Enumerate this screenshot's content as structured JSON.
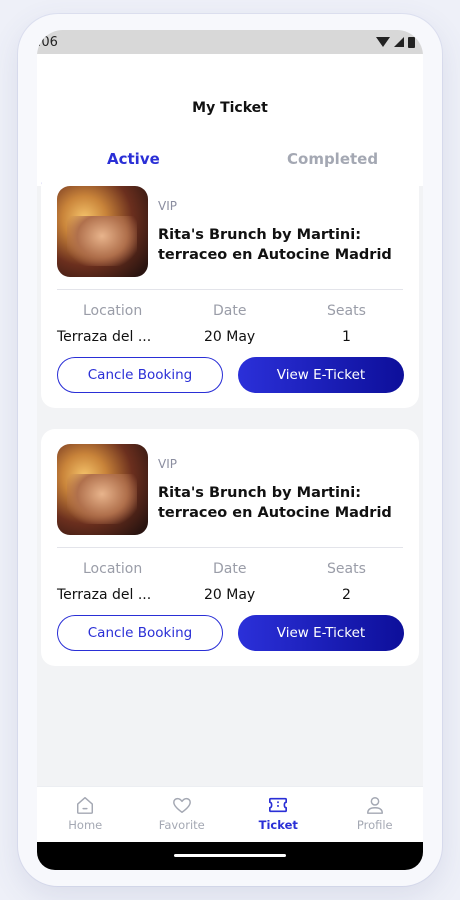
{
  "status": {
    "time": ":06"
  },
  "header": {
    "title": "My Ticket"
  },
  "tabs": [
    {
      "label": "Active",
      "active": true
    },
    {
      "label": "Completed",
      "active": false
    }
  ],
  "columns": {
    "location": "Location",
    "date": "Date",
    "seats": "Seats"
  },
  "tickets": [
    {
      "tier": "VIP",
      "title": "Rita's Brunch by Martini: terraceo en Autocine Madrid",
      "location": "Terraza del ...",
      "date": "20 May",
      "seats": "1",
      "cancel_label": "Cancle Booking",
      "view_label": "View E-Ticket"
    },
    {
      "tier": "VIP",
      "title": "Rita's Brunch by Martini: terraceo en Autocine Madrid",
      "location": "Terraza del ...",
      "date": "20 May",
      "seats": "2",
      "cancel_label": "Cancle Booking",
      "view_label": "View E-Ticket"
    }
  ],
  "nav": [
    {
      "label": "Home",
      "icon": "home-icon",
      "active": false
    },
    {
      "label": "Favorite",
      "icon": "heart-icon",
      "active": false
    },
    {
      "label": "Ticket",
      "icon": "ticket-icon",
      "active": true
    },
    {
      "label": "Profile",
      "icon": "user-icon",
      "active": false
    }
  ],
  "colors": {
    "accent": "#2a2fd6",
    "accent_dark": "#0d0f9a",
    "muted": "#a4a8b3"
  }
}
